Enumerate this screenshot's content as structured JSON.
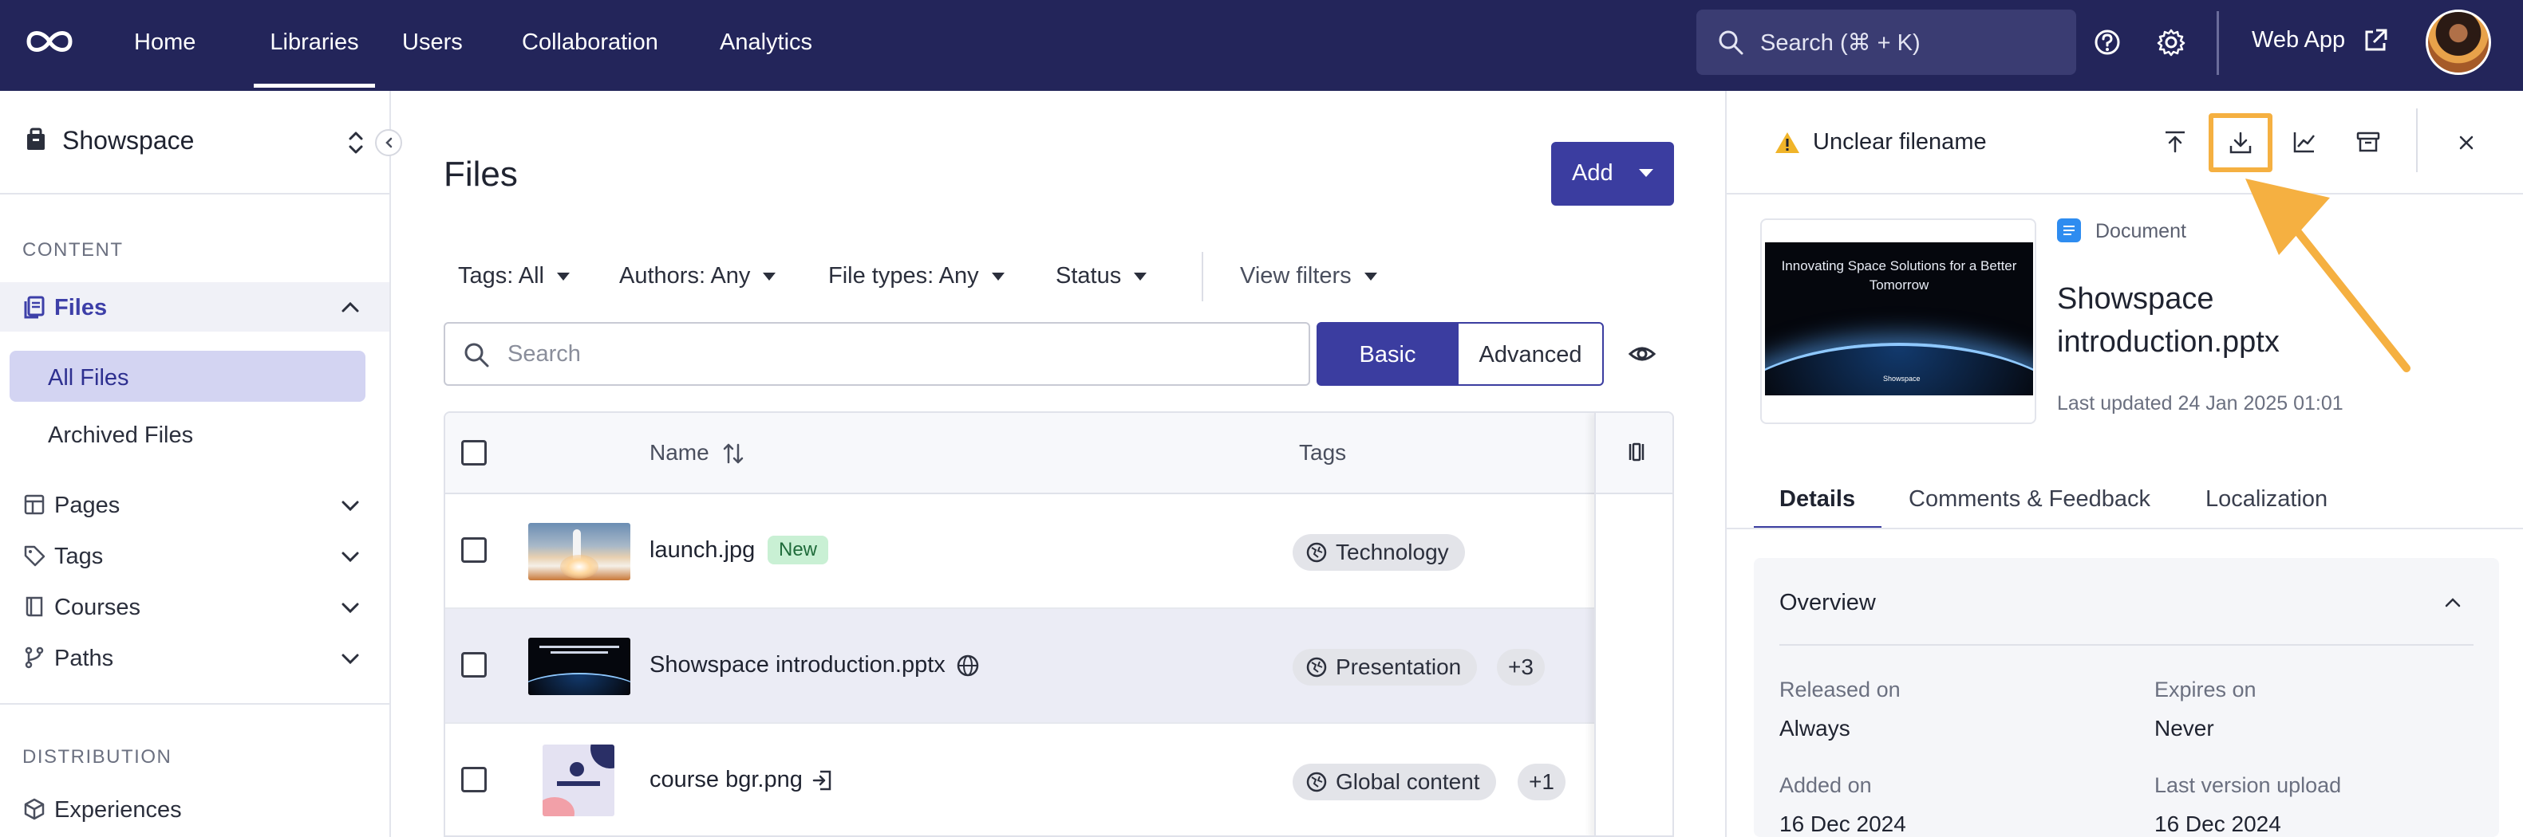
{
  "nav": {
    "items": [
      "Home",
      "Libraries",
      "Users",
      "Collaboration",
      "Analytics"
    ],
    "active": "Libraries",
    "search_placeholder": "Search (⌘ + K)",
    "web_app": "Web App"
  },
  "sidebar": {
    "workspace": "Showspace",
    "section_content": "CONTENT",
    "files": "Files",
    "all_files": "All Files",
    "archived_files": "Archived Files",
    "pages": "Pages",
    "tags": "Tags",
    "courses": "Courses",
    "paths": "Paths",
    "section_distribution": "DISTRIBUTION",
    "experiences": "Experiences"
  },
  "main": {
    "title": "Files",
    "add_label": "Add",
    "filters": [
      "Tags: All",
      "Authors: Any",
      "File types: Any",
      "Status"
    ],
    "view_filters": "View filters",
    "search_placeholder": "Search",
    "mode_basic": "Basic",
    "mode_advanced": "Advanced"
  },
  "table": {
    "col_name": "Name",
    "col_tags": "Tags",
    "rows": [
      {
        "name": "launch.jpg",
        "badge": "New",
        "tag": "Technology",
        "more": ""
      },
      {
        "name": "Showspace introduction.pptx",
        "badge": "",
        "tag": "Presentation",
        "more": "+3"
      },
      {
        "name": "course bgr.png",
        "badge": "",
        "tag": "Global content",
        "more": "+1"
      }
    ]
  },
  "panel": {
    "warning": "Unclear filename",
    "doc_type": "Document",
    "title": "Showspace introduction.pptx",
    "updated": "Last updated 24 Jan 2025 01:01",
    "slide_title": "Innovating Space Solutions for a Better Tomorrow",
    "slide_logo": "Showspace",
    "tabs": [
      "Details",
      "Comments & Feedback",
      "Localization"
    ],
    "overview_title": "Overview",
    "released_on_label": "Released on",
    "released_on": "Always",
    "expires_on_label": "Expires on",
    "expires_on": "Never",
    "added_on_label": "Added on",
    "added_on": "16 Dec 2024",
    "last_upload_label": "Last version upload",
    "last_upload": "16 Dec 2024"
  },
  "colors": {
    "nav_bg": "#23255a",
    "accent": "#3b3da0",
    "highlight": "#f5b041",
    "new_badge": "#c9f0d4"
  }
}
